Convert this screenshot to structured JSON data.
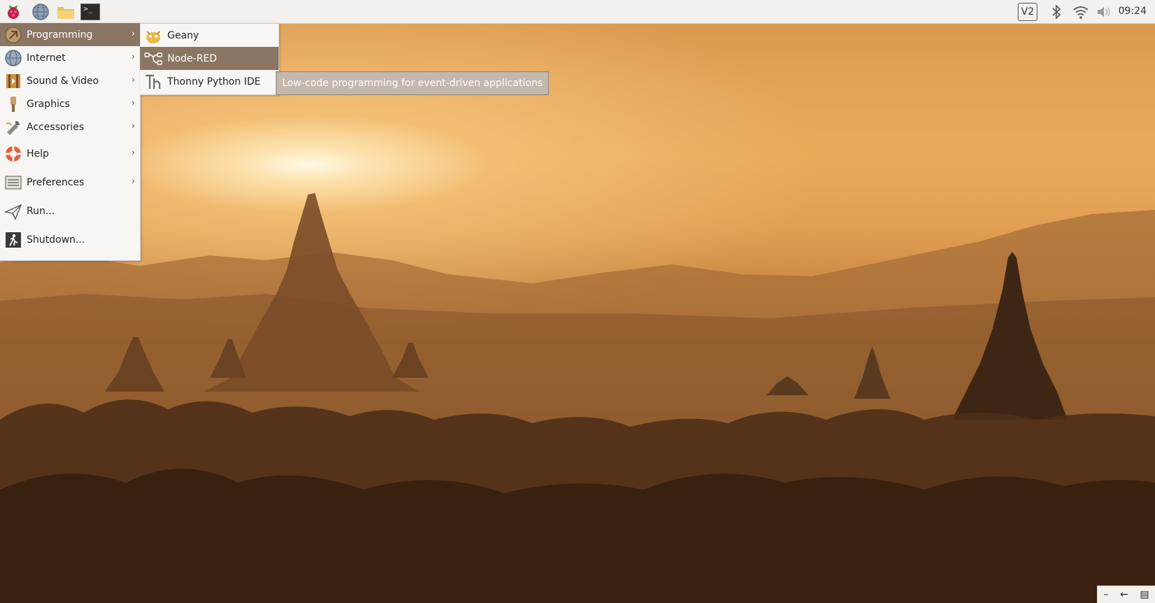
{
  "panel": {
    "clock": "09:24",
    "launchers": [
      {
        "icon": "raspberry-menu-icon"
      },
      {
        "icon": "web-browser-icon"
      },
      {
        "icon": "file-manager-icon"
      },
      {
        "icon": "terminal-icon",
        "glyph": ">_"
      }
    ],
    "tray": {
      "vnc_label": "V2",
      "bluetooth_icon": "bluetooth-icon",
      "wifi_icon": "wifi-icon",
      "volume_icon": "volume-icon"
    }
  },
  "menu": {
    "items": [
      {
        "label": "Programming",
        "icon": "programming-icon",
        "submenu": true,
        "active": true
      },
      {
        "label": "Internet",
        "icon": "internet-icon",
        "submenu": true
      },
      {
        "label": "Sound & Video",
        "icon": "sound-video-icon",
        "submenu": true
      },
      {
        "label": "Graphics",
        "icon": "graphics-icon",
        "submenu": true
      },
      {
        "label": "Accessories",
        "icon": "accessories-icon",
        "submenu": true
      },
      {
        "label": "Help",
        "icon": "help-icon",
        "submenu": true
      },
      {
        "label": "Preferences",
        "icon": "preferences-icon",
        "submenu": true
      },
      {
        "label": "Run...",
        "icon": "run-icon",
        "submenu": false
      },
      {
        "label": "Shutdown...",
        "icon": "shutdown-icon",
        "submenu": false
      }
    ],
    "arrow": "›"
  },
  "submenu": {
    "items": [
      {
        "label": "Geany",
        "icon": "geany-icon"
      },
      {
        "label": "Node-RED",
        "icon": "node-red-icon",
        "active": true
      },
      {
        "label": "Thonny Python IDE",
        "icon": "thonny-icon"
      }
    ]
  },
  "tooltip": {
    "text": "Low-code programming for event-driven applications"
  },
  "minibar": {
    "minimize": "–",
    "back": "←",
    "desktop": "▤"
  },
  "colors": {
    "menu_highlight": "#8b7663",
    "panel_bg": "#f3f1ee",
    "tooltip_bg": "#c4b7ab"
  }
}
